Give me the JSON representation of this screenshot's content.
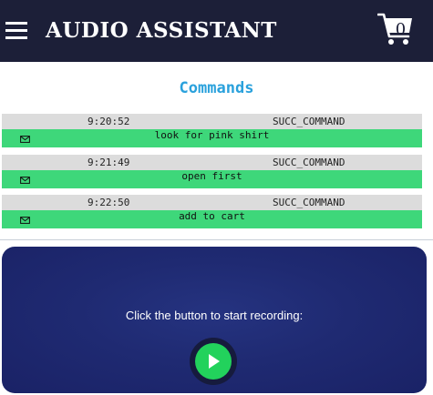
{
  "header": {
    "title": "AUDIO ASSISTANT",
    "cart_count": "0",
    "menu_icon": "hamburger-icon",
    "cart_icon": "shopping-cart-icon",
    "background_color": "#1c1f38"
  },
  "commands": {
    "title": "Commands",
    "title_color": "#2aa1dc",
    "items": [
      {
        "time": "9:20:52",
        "status": "SUCC_COMMAND",
        "text": "look for pink shirt",
        "icon": "mail-icon"
      },
      {
        "time": "9:21:49",
        "status": "SUCC_COMMAND",
        "text": "open first",
        "icon": "mail-icon"
      },
      {
        "time": "9:22:50",
        "status": "SUCC_COMMAND",
        "text": "add to cart",
        "icon": "mail-icon"
      }
    ],
    "meta_color": "#dcdcdc",
    "body_color": "#3ed77a"
  },
  "recorder": {
    "prompt": "Click the button to start recording:",
    "button_icon": "play-icon",
    "button_color": "#22d25c",
    "panel_color": "#1f2a72"
  }
}
